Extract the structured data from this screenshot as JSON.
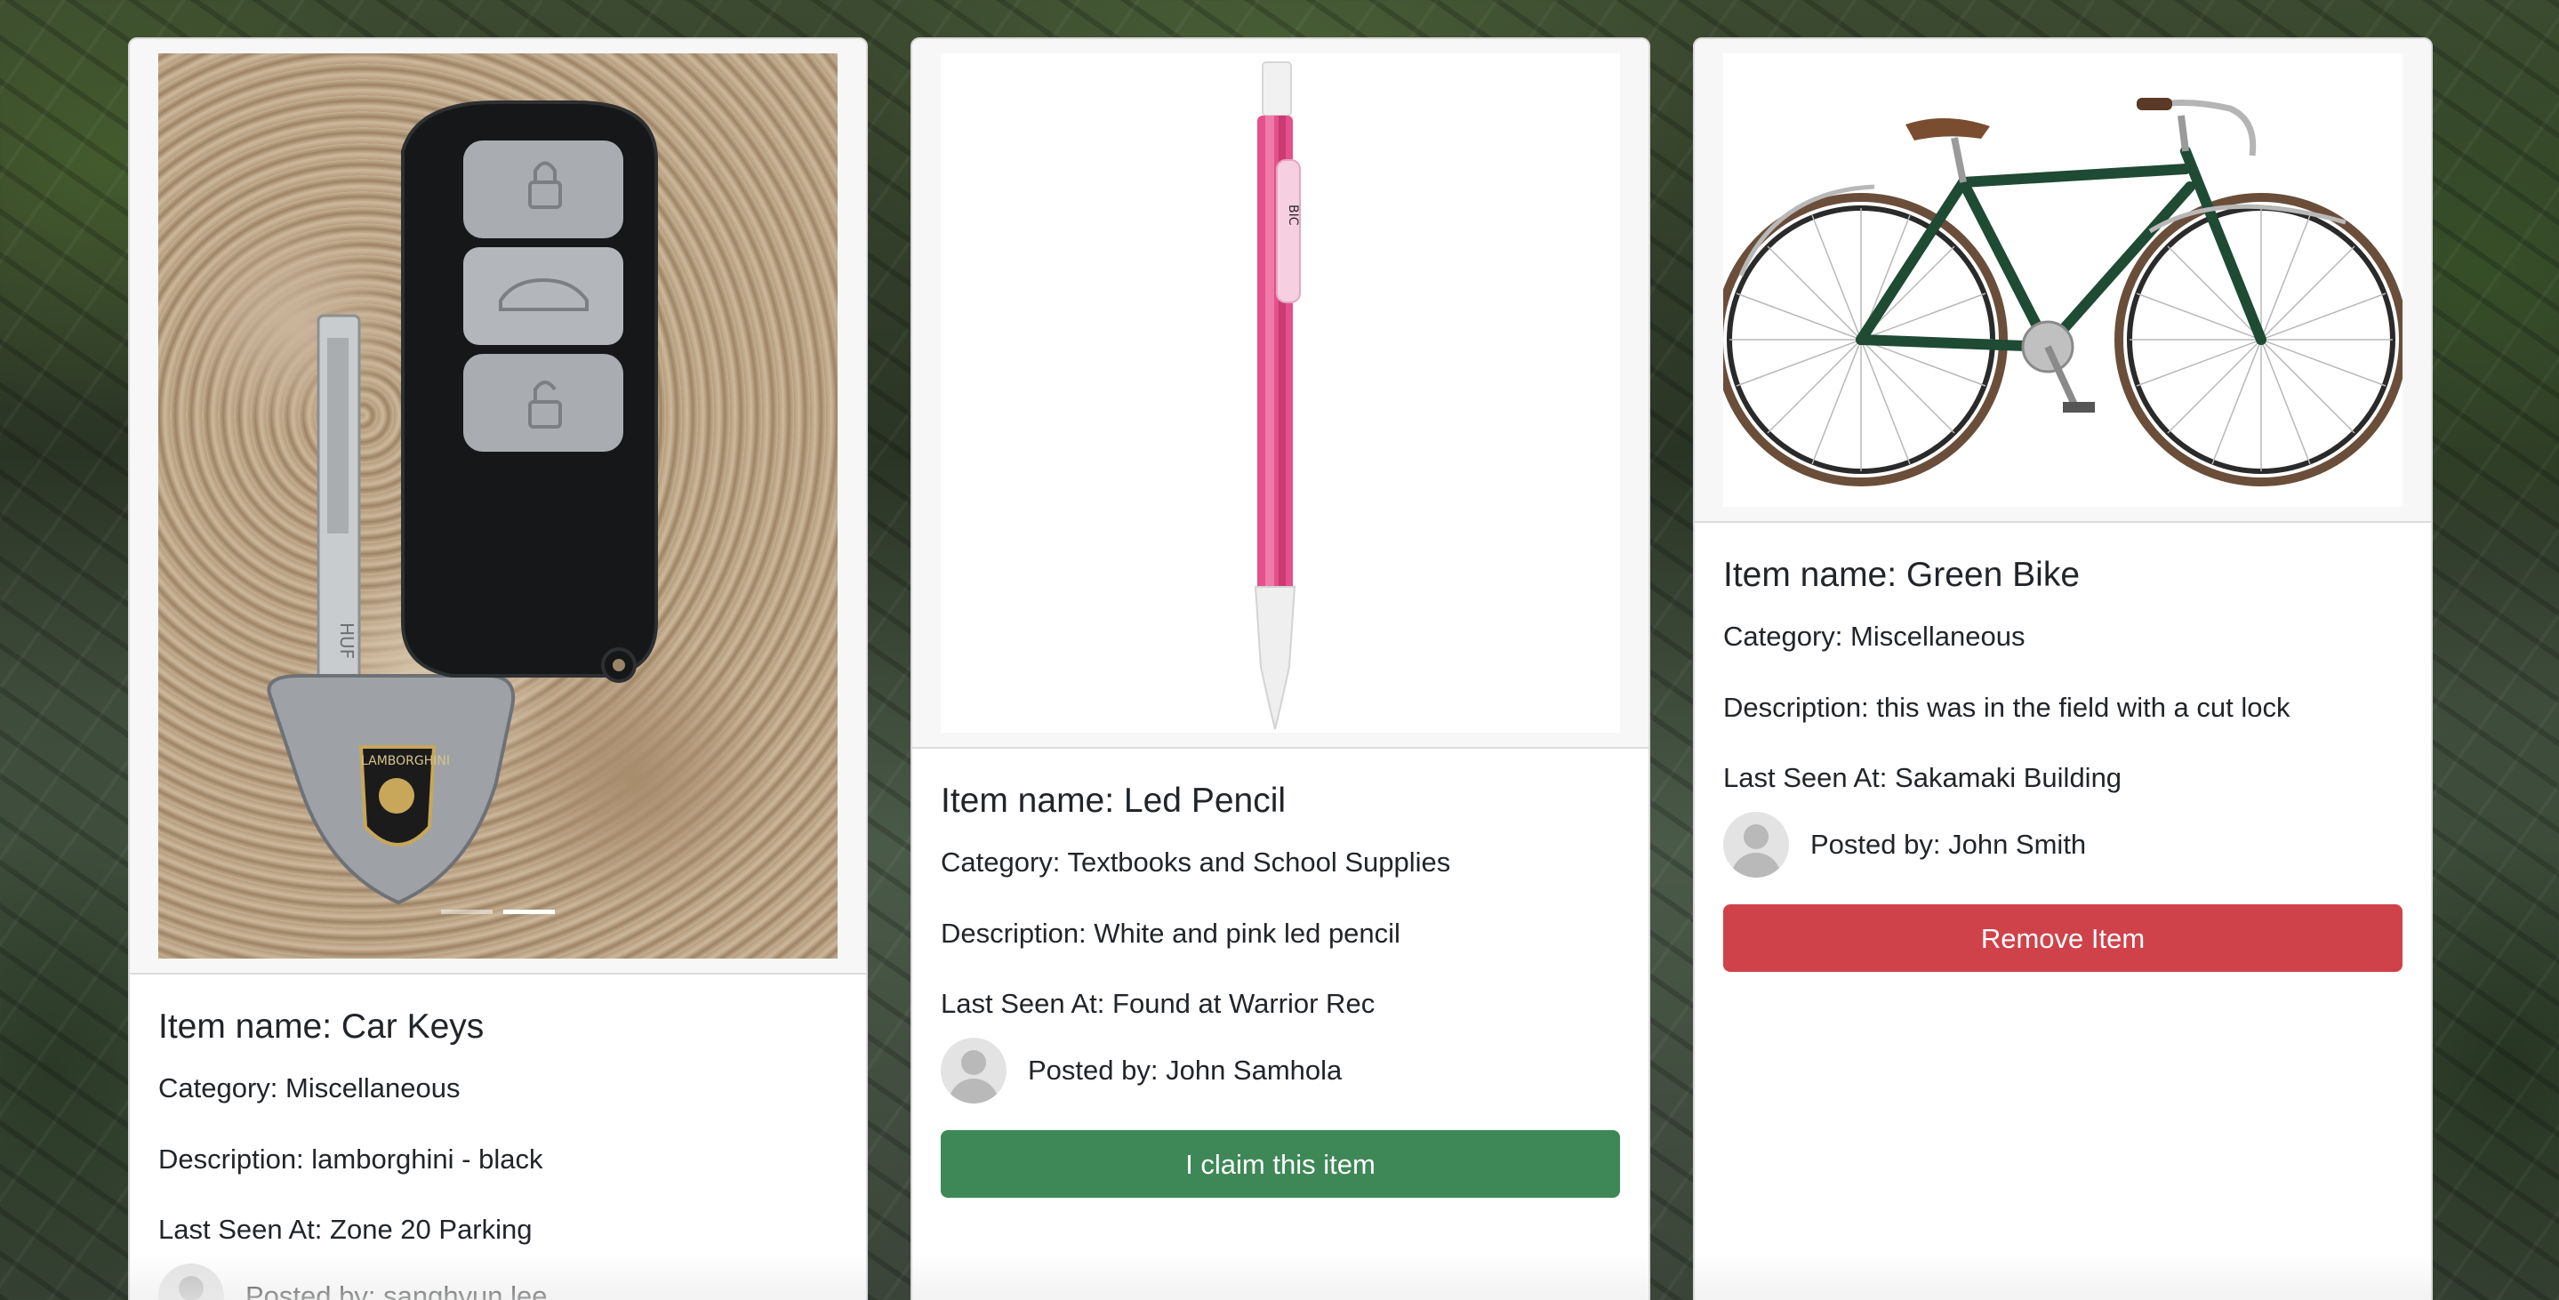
{
  "cards": [
    {
      "item_name": "Item name: Car Keys",
      "category": "Category: Miscellaneous",
      "description": "Description: lamborghini - black",
      "last_seen": "Last Seen At: Zone 20 Parking",
      "posted_by": "Posted by: sanghyun lee",
      "image_icon": "car-key-fob-image",
      "carousel": {
        "slides": 2,
        "active": 2
      }
    },
    {
      "item_name": "Item name: Led Pencil",
      "category": "Category: Textbooks and School Supplies",
      "description": "Description: White and pink led pencil",
      "last_seen": "Last Seen At: Found at Warrior Rec",
      "posted_by": "Posted by: John Samhola",
      "button_label": "I claim this item",
      "button_color": "#3e8757",
      "image_icon": "pencil-image"
    },
    {
      "item_name": "Item name: Green Bike",
      "category": "Category: Miscellaneous",
      "description": "Description: this was in the field with a cut lock",
      "last_seen": "Last Seen At: Sakamaki Building",
      "posted_by": "Posted by: John Smith",
      "button_label": "Remove Item",
      "button_color": "#d0424a",
      "image_icon": "bicycle-image"
    }
  ]
}
